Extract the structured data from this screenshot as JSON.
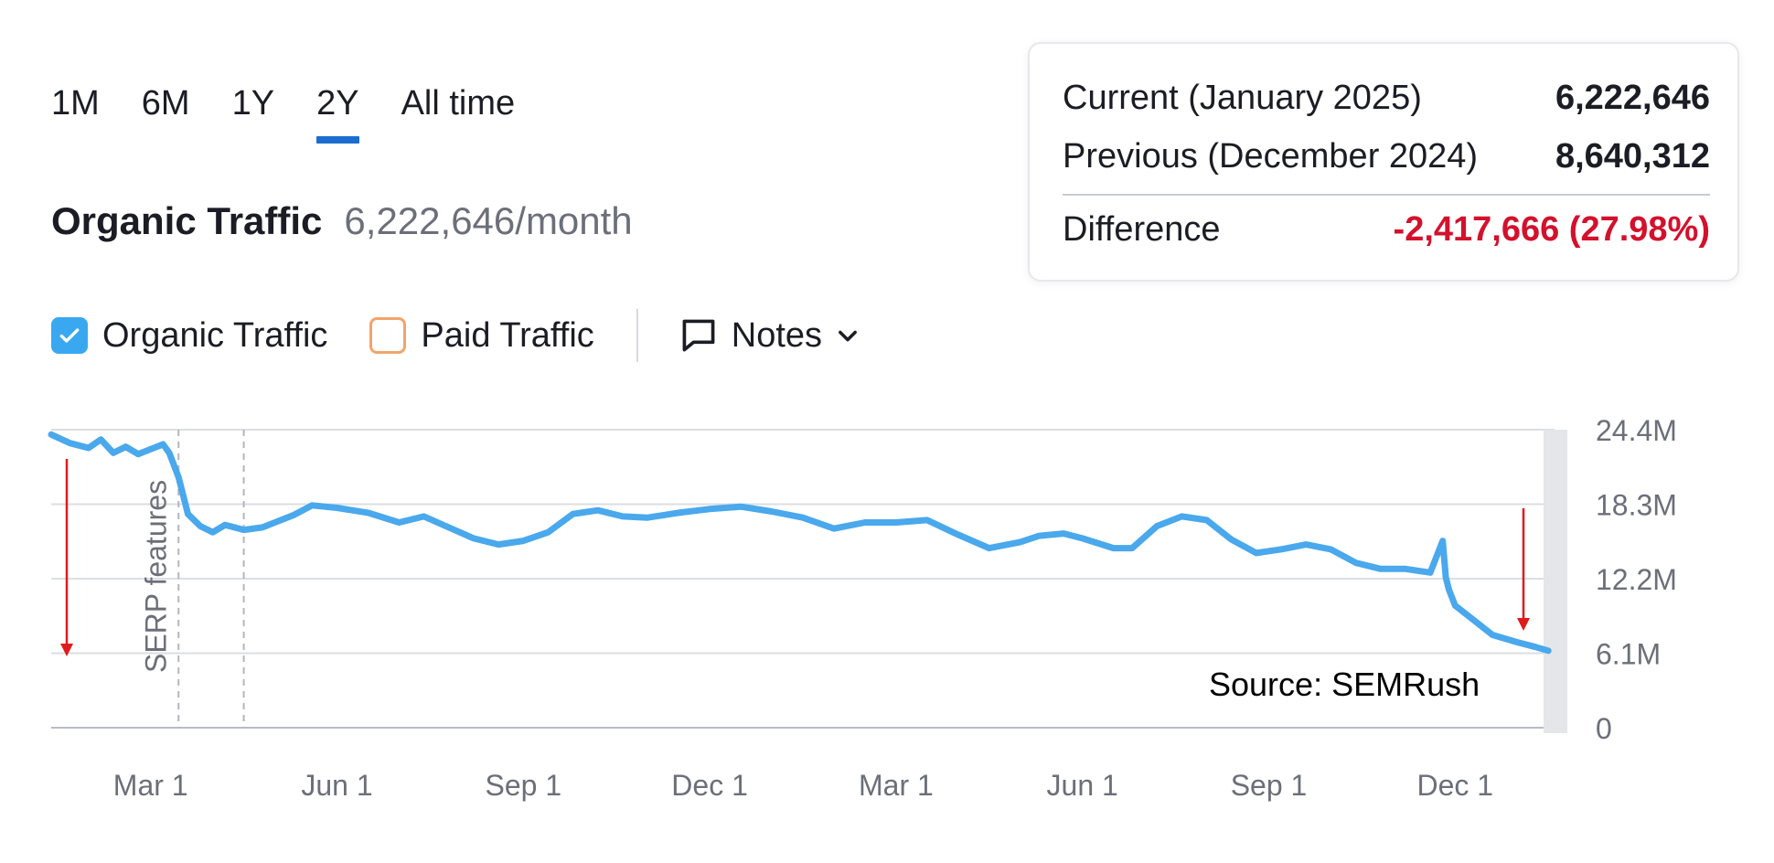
{
  "range_tabs": [
    {
      "label": "1M",
      "active": false
    },
    {
      "label": "6M",
      "active": false
    },
    {
      "label": "1Y",
      "active": false
    },
    {
      "label": "2Y",
      "active": true
    },
    {
      "label": "All time",
      "active": false
    }
  ],
  "header": {
    "title": "Organic Traffic",
    "value": "6,222,646/month"
  },
  "legend": {
    "organic": {
      "label": "Organic Traffic",
      "checked": true,
      "color": "#39a8f0"
    },
    "paid": {
      "label": "Paid Traffic",
      "checked": false,
      "color": "#f2a46a"
    },
    "notes_label": "Notes"
  },
  "tooltip": {
    "current_label": "Current (January 2025)",
    "current_value": "6,222,646",
    "previous_label": "Previous (December 2024)",
    "previous_value": "8,640,312",
    "difference_label": "Difference",
    "difference_value": "-2,417,666 (27.98%)",
    "negative_color": "#d3112d"
  },
  "source": "Source: SEMRush",
  "chart_data": {
    "type": "line",
    "y_ticks": [
      "24.4M",
      "18.3M",
      "12.2M",
      "6.1M",
      "0"
    ],
    "y_tick_values": [
      24.4,
      18.3,
      12.2,
      6.1,
      0
    ],
    "ylim": [
      0,
      24.4
    ],
    "x_ticks": [
      "Mar 1",
      "Jun 1",
      "Sep 1",
      "Dec 1",
      "Mar 1",
      "Jun 1",
      "Sep 1",
      "Dec 1"
    ],
    "x_tick_positions": [
      1.0,
      4.0,
      7.0,
      10.0,
      13.0,
      16.0,
      19.0,
      22.0
    ],
    "xlim": [
      -0.6,
      23.6
    ],
    "annotations": [
      {
        "label": "SERP features",
        "x": 1.45
      },
      {
        "label": "",
        "x": 2.5
      }
    ],
    "grid": true,
    "line_color": "#4aa8ec",
    "series": [
      {
        "x": [
          -0.6,
          -0.3,
          0.0,
          0.2,
          0.4,
          0.6,
          0.8,
          1.0,
          1.2,
          1.3,
          1.45,
          1.6,
          1.8,
          2.0,
          2.2,
          2.5,
          2.8,
          3.0,
          3.3,
          3.6,
          4.0,
          4.5,
          5.0,
          5.4,
          5.8,
          6.2,
          6.6,
          7.0,
          7.4,
          7.8,
          8.2,
          8.6,
          9.0,
          9.5,
          10.0,
          10.5,
          11.0,
          11.5,
          12.0,
          12.5,
          13.0,
          13.5,
          14.0,
          14.5,
          15.0,
          15.3,
          15.7,
          16.0,
          16.5,
          16.8,
          17.2,
          17.6,
          18.0,
          18.4,
          18.8,
          19.2,
          19.6,
          20.0,
          20.4,
          20.8,
          21.2,
          21.6,
          21.8,
          21.85,
          21.9,
          22.0,
          22.3,
          22.6,
          23.0,
          23.3,
          23.5
        ],
        "y": [
          24.0,
          23.3,
          22.9,
          23.6,
          22.5,
          23.0,
          22.4,
          22.8,
          23.2,
          22.5,
          20.5,
          17.5,
          16.5,
          16.0,
          16.6,
          16.2,
          16.4,
          16.8,
          17.4,
          18.2,
          18.0,
          17.6,
          16.8,
          17.3,
          16.4,
          15.5,
          15.0,
          15.3,
          16.0,
          17.5,
          17.8,
          17.3,
          17.2,
          17.6,
          17.9,
          18.1,
          17.7,
          17.2,
          16.3,
          16.8,
          16.8,
          17.0,
          15.8,
          14.7,
          15.2,
          15.7,
          15.9,
          15.5,
          14.7,
          14.7,
          16.5,
          17.3,
          17.0,
          15.4,
          14.3,
          14.6,
          15.0,
          14.6,
          13.5,
          13.0,
          13.0,
          12.7,
          15.3,
          12.3,
          11.3,
          10.0,
          8.8,
          7.6,
          7.0,
          6.6,
          6.3
        ]
      }
    ]
  }
}
